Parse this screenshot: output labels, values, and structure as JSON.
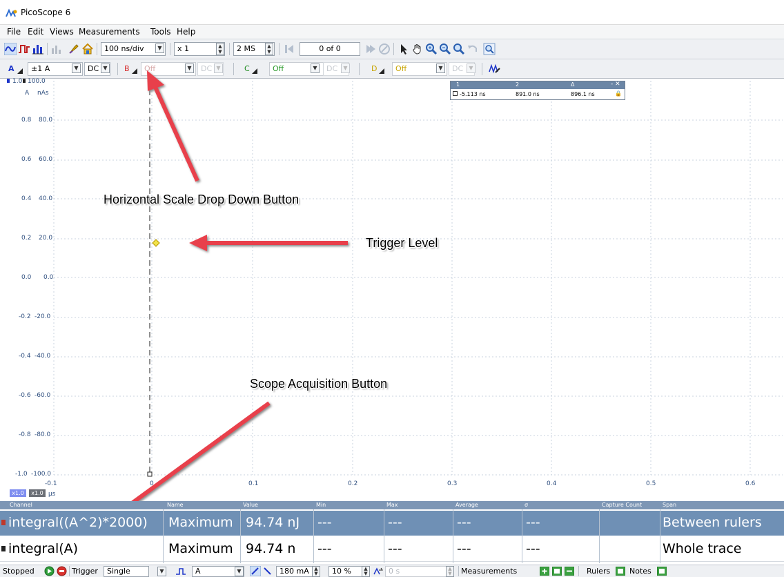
{
  "window": {
    "title": "PicoScope 6",
    "icon": "picoscope-logo-icon"
  },
  "menu": [
    "File",
    "Edit",
    "Views",
    "Measurements",
    "Tools",
    "Help"
  ],
  "toolbar": {
    "timebase": "100 ns/div",
    "zoom": "x 1",
    "samples": "2 MS",
    "buffer": "0 of 0",
    "icons": [
      "scope-mode-icon",
      "persistence-mode-icon",
      "spectrum-mode-icon",
      "xy-mode-icon",
      "probe-icon",
      "home-icon",
      "pointer-icon",
      "hand-icon",
      "zoom-in-icon",
      "zoom-out-icon",
      "zoom-fit-icon",
      "undo-zoom-icon",
      "zoom-overview-icon"
    ]
  },
  "channels": {
    "a": {
      "label": "A",
      "range": "±1 A",
      "coupling": "DC",
      "color": "#1d35c9"
    },
    "b": {
      "label": "B",
      "range": "Off",
      "coupling": "DC",
      "color": "#d62828"
    },
    "c": {
      "label": "C",
      "range": "Off",
      "coupling": "DC",
      "color": "#1c8a1c"
    },
    "d": {
      "label": "D",
      "range": "Off",
      "coupling": "DC",
      "color": "#c8a400"
    }
  },
  "axes": {
    "y_top_unit_a": "A",
    "y_top_unit_b": "nAs",
    "y_first_a": "1.0",
    "y_first_b": "100.0",
    "y_labels_a": [
      "0.8",
      "0.6",
      "0.4",
      "0.2",
      "0.0",
      "-0.2",
      "-0.4",
      "-0.6",
      "-0.8",
      "-1.0"
    ],
    "y_labels_b": [
      "80.0",
      "60.0",
      "40.0",
      "20.0",
      "0.0",
      "-20.0",
      "-40.0",
      "-60.0",
      "-80.0",
      "-100.0"
    ],
    "x_labels": [
      "-0.1",
      "0",
      "0.1",
      "0.2",
      "0.3",
      "0.4",
      "0.5",
      "0.6"
    ],
    "x_unit": "µs",
    "zoom_a": "x1.0",
    "zoom_b": "x1.0"
  },
  "rulers": {
    "headers": [
      "1",
      "2",
      "Δ"
    ],
    "values": [
      "-5.113 ns",
      "891.0 ns",
      "896.1 ns"
    ]
  },
  "annotations": {
    "horizontal_scale": "Horizontal Scale Drop Down Button",
    "trigger_level": "Trigger Level",
    "acquisition": "Scope Acquisition Button"
  },
  "measurements": {
    "headers": [
      "Channel",
      "Name",
      "Value",
      "Min",
      "Max",
      "Average",
      "σ",
      "Capture Count",
      "Span"
    ],
    "rows": [
      {
        "channel": "integral((A^2)*2000)",
        "name": "Maximum",
        "value": "94.74 nJ",
        "min": "---",
        "max": "---",
        "average": "---",
        "sigma": "---",
        "count": "",
        "span": "Between rulers",
        "selected": true
      },
      {
        "channel": "integral(A)",
        "name": "Maximum",
        "value": "94.74 n",
        "min": "---",
        "max": "---",
        "average": "---",
        "sigma": "---",
        "count": "",
        "span": "Whole trace",
        "selected": false
      }
    ]
  },
  "status": {
    "state": "Stopped",
    "trigger_label": "Trigger",
    "trigger_mode": "Single",
    "trigger_channel": "A",
    "trigger_level": "180 mA",
    "pretrigger": "10 %",
    "delay": "0 s",
    "measurements_label": "Measurements",
    "rulers_label": "Rulers",
    "notes_label": "Notes"
  }
}
